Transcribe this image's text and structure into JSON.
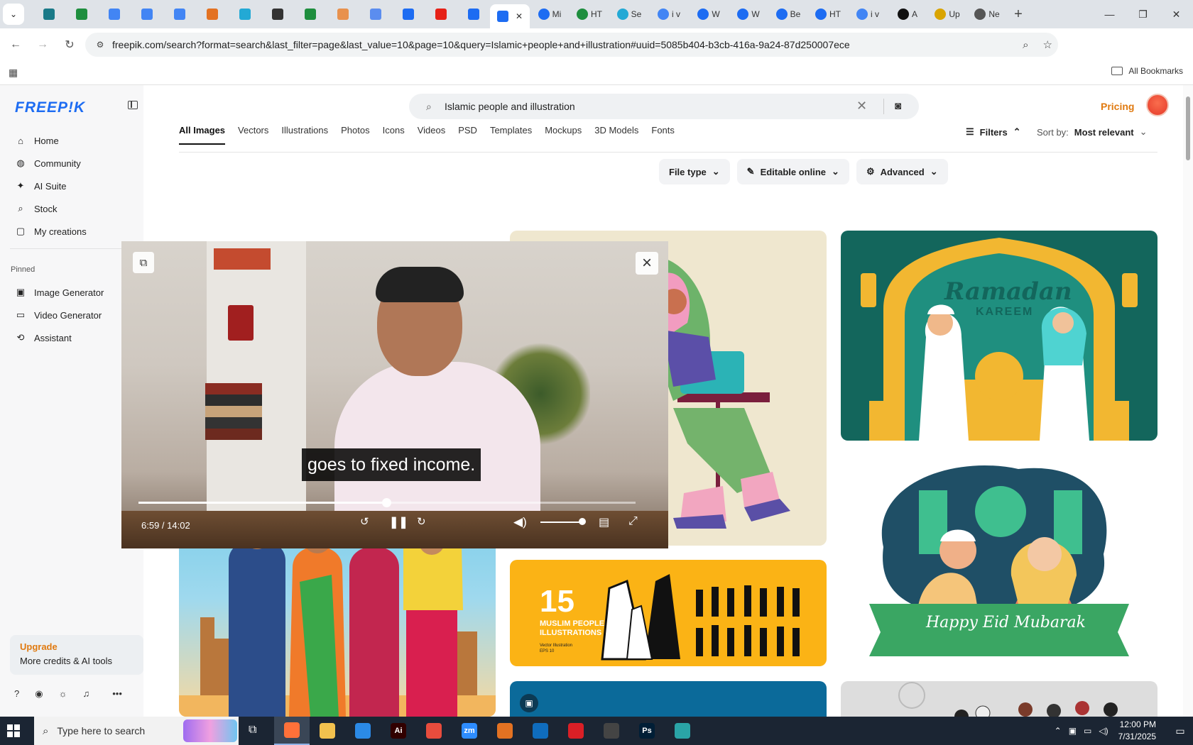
{
  "browser": {
    "tabs": [
      {
        "icon": "chevron-down",
        "color": "#444"
      },
      {
        "icon": "vpn",
        "color": "#1a7a88"
      },
      {
        "icon": "sheets",
        "color": "#1e8e3e"
      },
      {
        "icon": "docs",
        "color": "#4285f4"
      },
      {
        "icon": "docs",
        "color": "#4285f4"
      },
      {
        "icon": "docs",
        "color": "#4285f4"
      },
      {
        "icon": "html",
        "color": "#e37222"
      },
      {
        "icon": "vscode",
        "color": "#23a9d5"
      },
      {
        "icon": "openai",
        "color": "#333"
      },
      {
        "icon": "sheets",
        "color": "#1e8e3e"
      },
      {
        "icon": "hand",
        "color": "#e8914d"
      },
      {
        "icon": "pdf",
        "color": "#5b8def"
      },
      {
        "icon": "forms",
        "color": "#1d6cf2"
      },
      {
        "icon": "youtube",
        "color": "#e62117"
      },
      {
        "icon": "forms",
        "color": "#1d6cf2"
      }
    ],
    "active_tab": {
      "close": "✕",
      "color": "#1d6cf2"
    },
    "text_tabs": [
      {
        "label": "Mi",
        "color": "#1d6cf2"
      },
      {
        "label": "HT",
        "color": "#1e8e3e"
      },
      {
        "label": "Se",
        "color": "#23a9d5"
      },
      {
        "label": "i v",
        "color": "#4285f4"
      },
      {
        "label": "W",
        "color": "#1d6cf2"
      },
      {
        "label": "W",
        "color": "#1d6cf2"
      },
      {
        "label": "Be",
        "color": "#1d6cf2"
      },
      {
        "label": "HT",
        "color": "#1d6cf2"
      },
      {
        "label": "i v",
        "color": "#4285f4"
      },
      {
        "label": "A",
        "color": "#111"
      },
      {
        "label": "Up",
        "color": "#d9a400"
      },
      {
        "label": "Ne",
        "color": "#555"
      }
    ],
    "new_tab": "+",
    "window": {
      "minimize": "—",
      "restore": "❐",
      "close": "✕"
    },
    "url": "freepik.com/search?format=search&last_filter=page&last_value=10&page=10&query=Islamic+people+and+illustration#uuid=5085b404-b3cb-416a-9a24-87d250007ece",
    "bookmarks_label": "All Bookmarks"
  },
  "sidebar": {
    "logo": "FREEP!K",
    "nav": [
      {
        "label": "Home",
        "icon": "⌂"
      },
      {
        "label": "Community",
        "icon": "◍"
      },
      {
        "label": "AI Suite",
        "icon": "✦"
      },
      {
        "label": "Stock",
        "icon": "⌕"
      },
      {
        "label": "My creations",
        "icon": "▢"
      }
    ],
    "pinned_label": "Pinned",
    "pinned": [
      {
        "label": "Image Generator",
        "icon": "▣"
      },
      {
        "label": "Video Generator",
        "icon": "▭"
      },
      {
        "label": "Assistant",
        "icon": "⟲"
      }
    ],
    "upgrade_title": "Upgrade",
    "upgrade_sub": "More credits & AI tools"
  },
  "header": {
    "search_query": "Islamic people and illustration",
    "pricing": "Pricing"
  },
  "categories": [
    "All Images",
    "Vectors",
    "Illustrations",
    "Photos",
    "Icons",
    "Videos",
    "PSD",
    "Templates",
    "Mockups",
    "3D Models",
    "Fonts"
  ],
  "toolbar": {
    "filters": "Filters",
    "sort_label": "Sort by:",
    "sort_value": "Most relevant",
    "chips": [
      {
        "label": "File type",
        "icon": ""
      },
      {
        "label": "Editable online",
        "icon": "✎"
      },
      {
        "label": "Advanced",
        "icon": "⚙"
      }
    ]
  },
  "results": {
    "ramadan_title": "Ramadan",
    "ramadan_sub": "KAREEM",
    "eid_text": "Happy Eid Mubarak",
    "muslim_count": "15",
    "muslim_title": "MUSLIM PEOPLE",
    "muslim_title2": "ILLUSTRATIONS",
    "muslim_meta": "Vector Illustration",
    "muslim_meta2": "EPS 10"
  },
  "video": {
    "caption": "goes to fixed income.",
    "time": "6:59 / 14:02",
    "progress": 0.498,
    "volume": 1.0
  },
  "taskbar": {
    "search_placeholder": "Type here to search",
    "apps": [
      {
        "label": "",
        "color": "#ff7139",
        "name": "firefox"
      },
      {
        "label": "",
        "color": "#f2c14e",
        "name": "file-explorer"
      },
      {
        "label": "",
        "color": "#2b8ae6",
        "name": "vscode"
      },
      {
        "label": "Ai",
        "color": "#310000",
        "name": "illustrator"
      },
      {
        "label": "",
        "color": "#e84c3d",
        "name": "chrome"
      },
      {
        "label": "zm",
        "color": "#2d8cff",
        "name": "zoom"
      },
      {
        "label": "",
        "color": "#e37222",
        "name": "html-app"
      },
      {
        "label": "",
        "color": "#0f6cbd",
        "name": "outlook"
      },
      {
        "label": "",
        "color": "#da1f26",
        "name": "creative-cloud"
      },
      {
        "label": "",
        "color": "#444",
        "name": "pen-tool"
      },
      {
        "label": "Ps",
        "color": "#001e36",
        "name": "photoshop"
      },
      {
        "label": "",
        "color": "#2aa4a7",
        "name": "app-extra"
      }
    ],
    "time": "12:00 PM",
    "date": "7/31/2025"
  }
}
